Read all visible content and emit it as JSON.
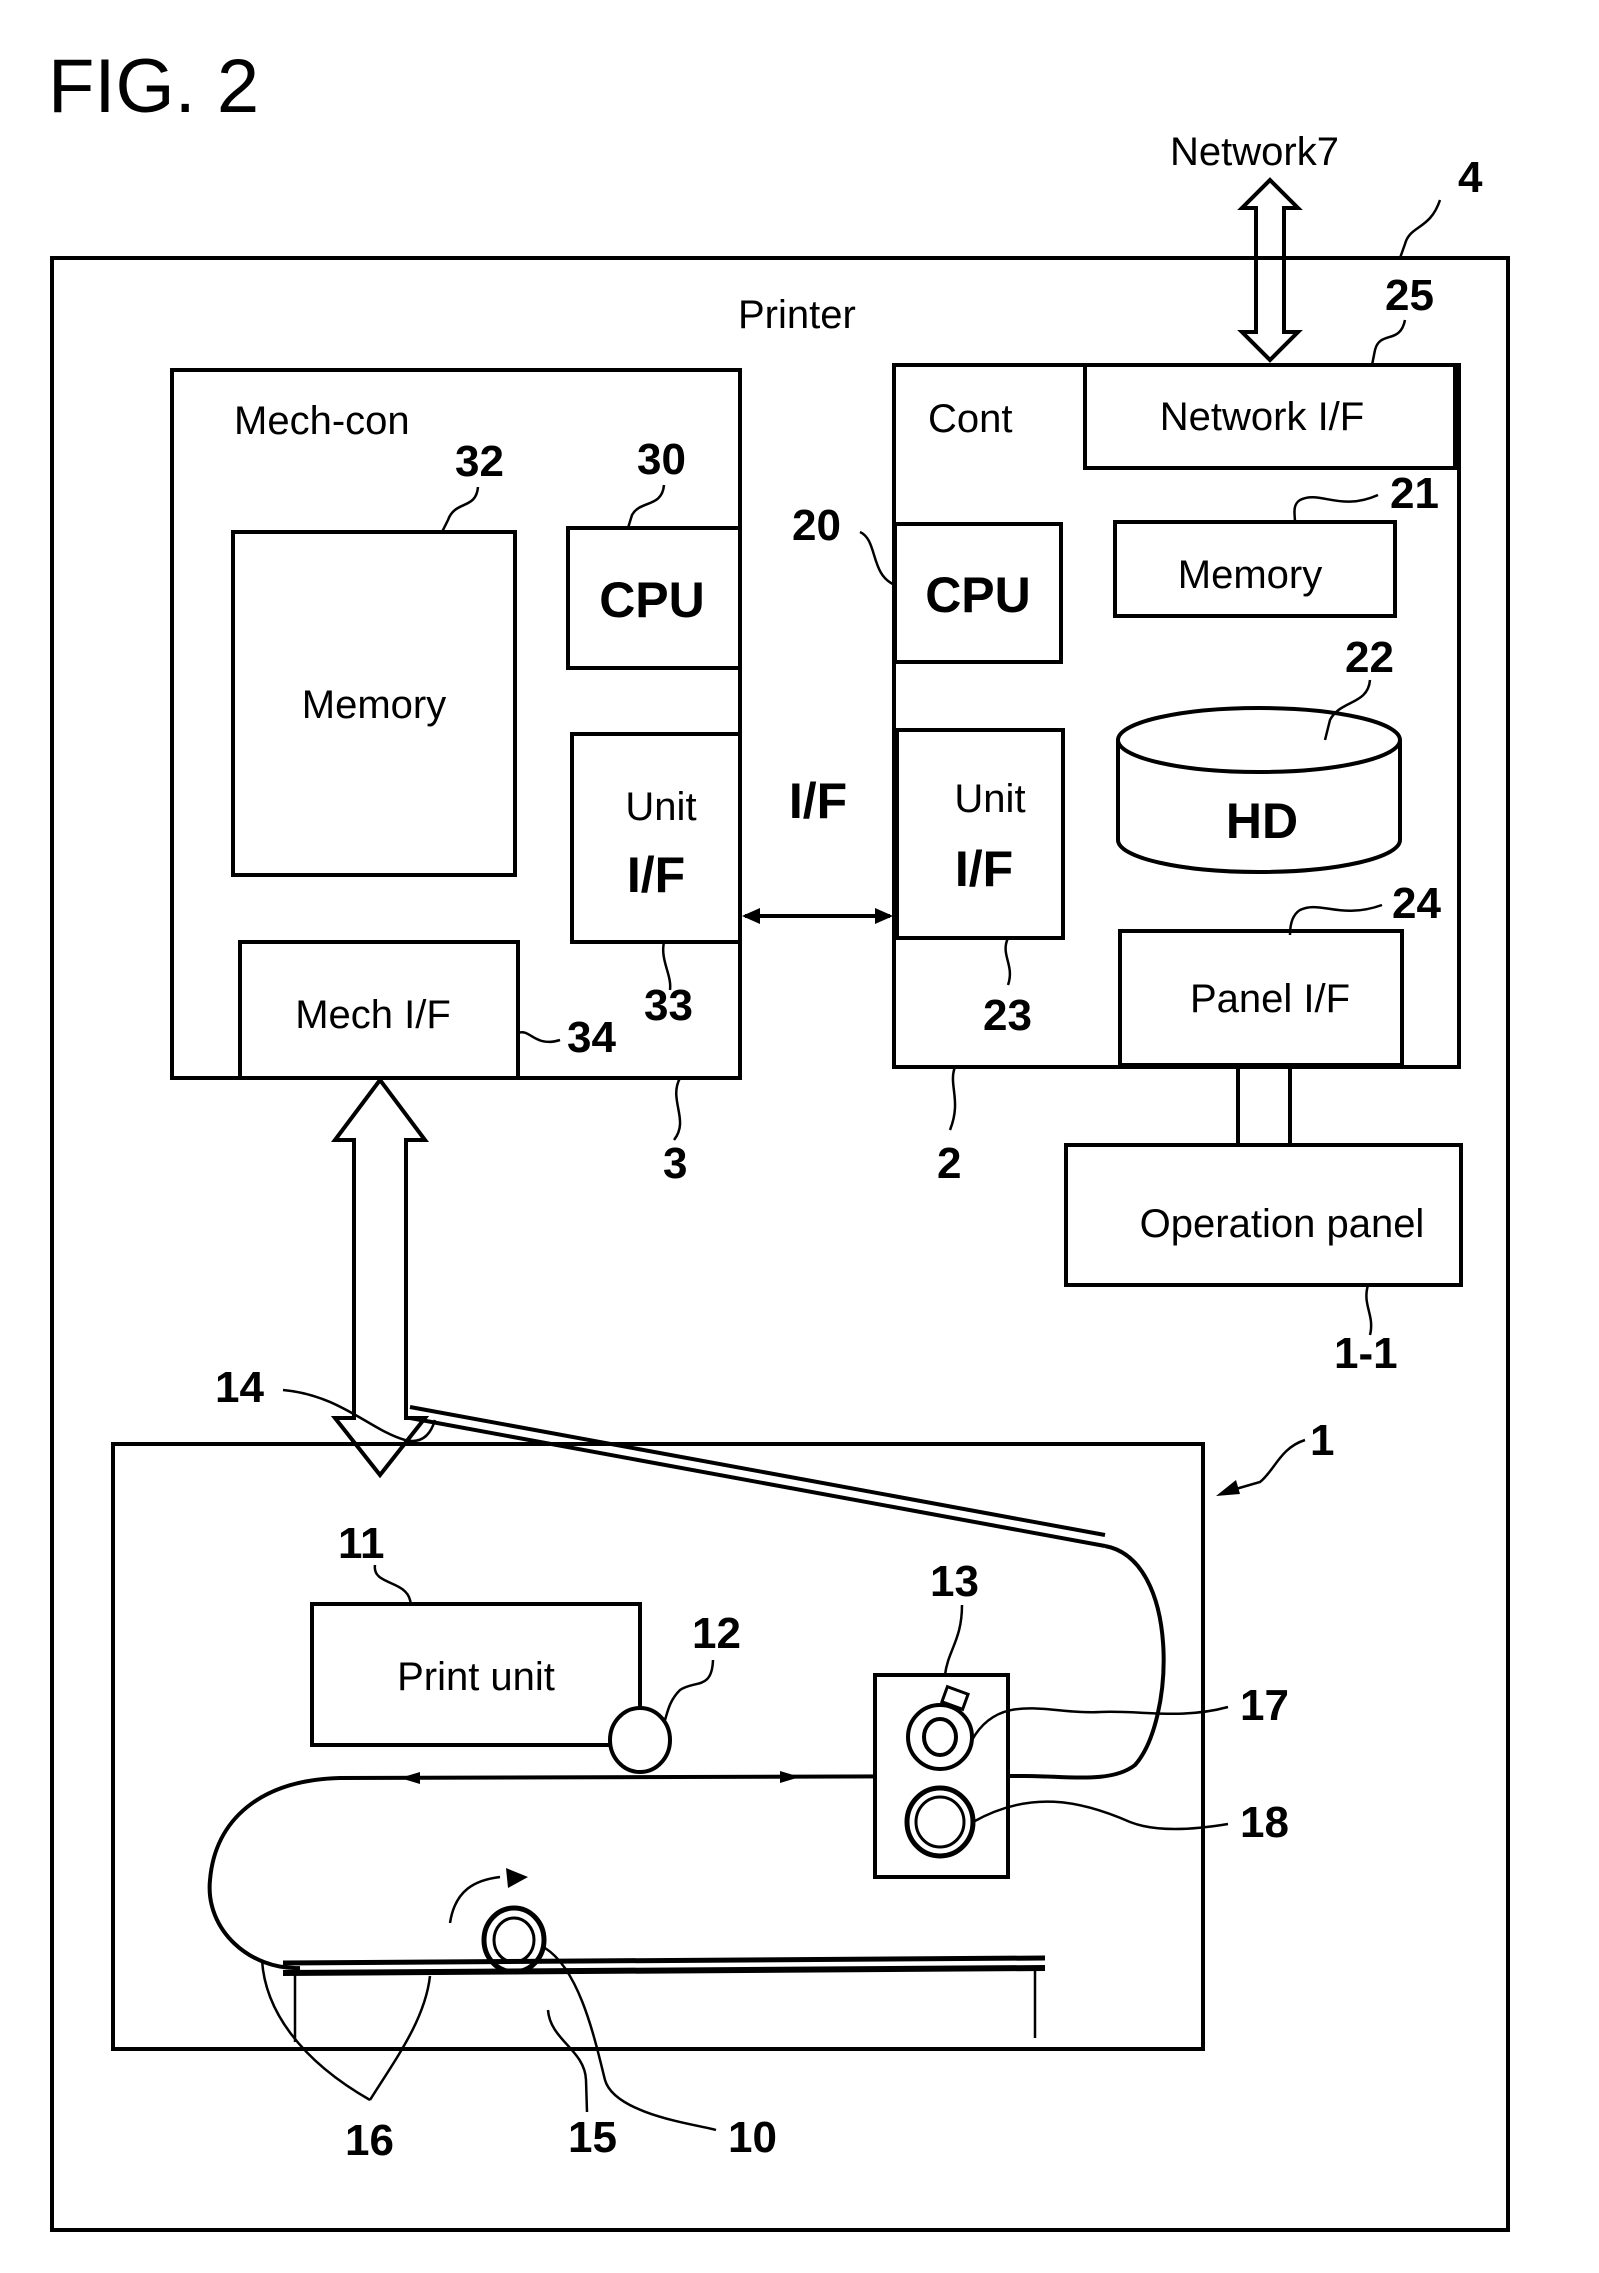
{
  "figure": {
    "title": "FIG. 2"
  },
  "network": {
    "label": "Network7"
  },
  "printer": {
    "label": "Printer",
    "ref": "4"
  },
  "mech_con": {
    "label": "Mech-con",
    "ref": "3",
    "memory": {
      "label": "Memory",
      "ref": "32"
    },
    "cpu": {
      "label": "CPU",
      "ref": "30"
    },
    "unit_if": {
      "line1": "Unit",
      "line2": "I/F",
      "ref": "33"
    },
    "mech_if": {
      "label": "Mech I/F",
      "ref": "34"
    }
  },
  "interface_link": {
    "label": "I/F"
  },
  "cont": {
    "label": "Cont",
    "ref": "2",
    "network_if": {
      "label": "Network I/F",
      "ref": "25"
    },
    "cpu": {
      "label": "CPU",
      "ref": "20"
    },
    "memory": {
      "label": "Memory",
      "ref": "21"
    },
    "hd": {
      "label": "HD",
      "ref": "22"
    },
    "unit_if": {
      "line1": "Unit",
      "line2": "I/F",
      "ref": "23"
    },
    "panel_if": {
      "label": "Panel  I/F",
      "ref": "24"
    }
  },
  "operation_panel": {
    "label": "Operation panel",
    "ref": "1-1"
  },
  "print_engine": {
    "ref": "1",
    "print_unit": {
      "label": "Print unit",
      "ref": "11"
    },
    "roller_12": {
      "ref": "12"
    },
    "fixing_unit": {
      "ref": "13"
    },
    "tray": {
      "ref": "14"
    },
    "cassette": {
      "ref": "15"
    },
    "paper_path": {
      "ref": "16"
    },
    "pickup_roller": {
      "ref": "10"
    },
    "heat_roller": {
      "ref": "17"
    },
    "pressure_roller": {
      "ref": "18"
    }
  }
}
